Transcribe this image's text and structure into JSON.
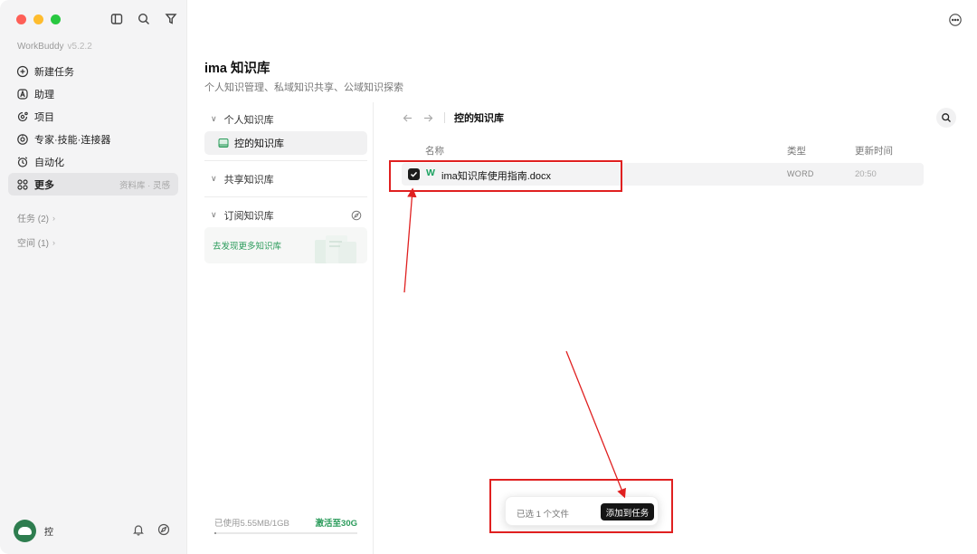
{
  "app": {
    "name": "WorkBuddy",
    "version": "v5.2.2"
  },
  "sidebar": {
    "items": [
      {
        "label": "新建任务",
        "icon": "plus-circle-icon"
      },
      {
        "label": "助理",
        "icon": "assistant-icon"
      },
      {
        "label": "项目",
        "icon": "project-icon"
      },
      {
        "label": "专家·技能·连接器",
        "icon": "expert-icon"
      },
      {
        "label": "自动化",
        "icon": "alarm-icon"
      },
      {
        "label": "更多",
        "icon": "grid-icon",
        "hint": "资料库 · 灵感"
      }
    ],
    "sections": {
      "tasks": "任务 (2)",
      "spaces": "空间 (1)"
    },
    "user": {
      "name": "控"
    }
  },
  "main": {
    "title": "ima 知识库",
    "subtitle": "个人知识管理、私域知识共享、公域知识探索"
  },
  "kb": {
    "personal": "个人知识库",
    "my_kb": "控的知识库",
    "shared": "共享知识库",
    "subscribed": "订阅知识库",
    "discover": "去发现更多知识库",
    "storage_used": "已使用5.55MB/1GB",
    "upgrade": "激活至30G",
    "storage_fraction": 0.0054
  },
  "files": {
    "breadcrumb": "控的知识库",
    "columns": {
      "name": "名称",
      "type": "类型",
      "time": "更新时间"
    },
    "rows": [
      {
        "name": "ima知识库使用指南.docx",
        "type": "WORD",
        "time": "20:50",
        "checked": true,
        "icon": "word-icon"
      }
    ]
  },
  "selection": {
    "count_text": "已选 1 个文件",
    "action": "添加到任务"
  },
  "colors": {
    "accent_green": "#2a9b5a",
    "annotation_red": "#e02020",
    "dark_button": "#151515"
  }
}
